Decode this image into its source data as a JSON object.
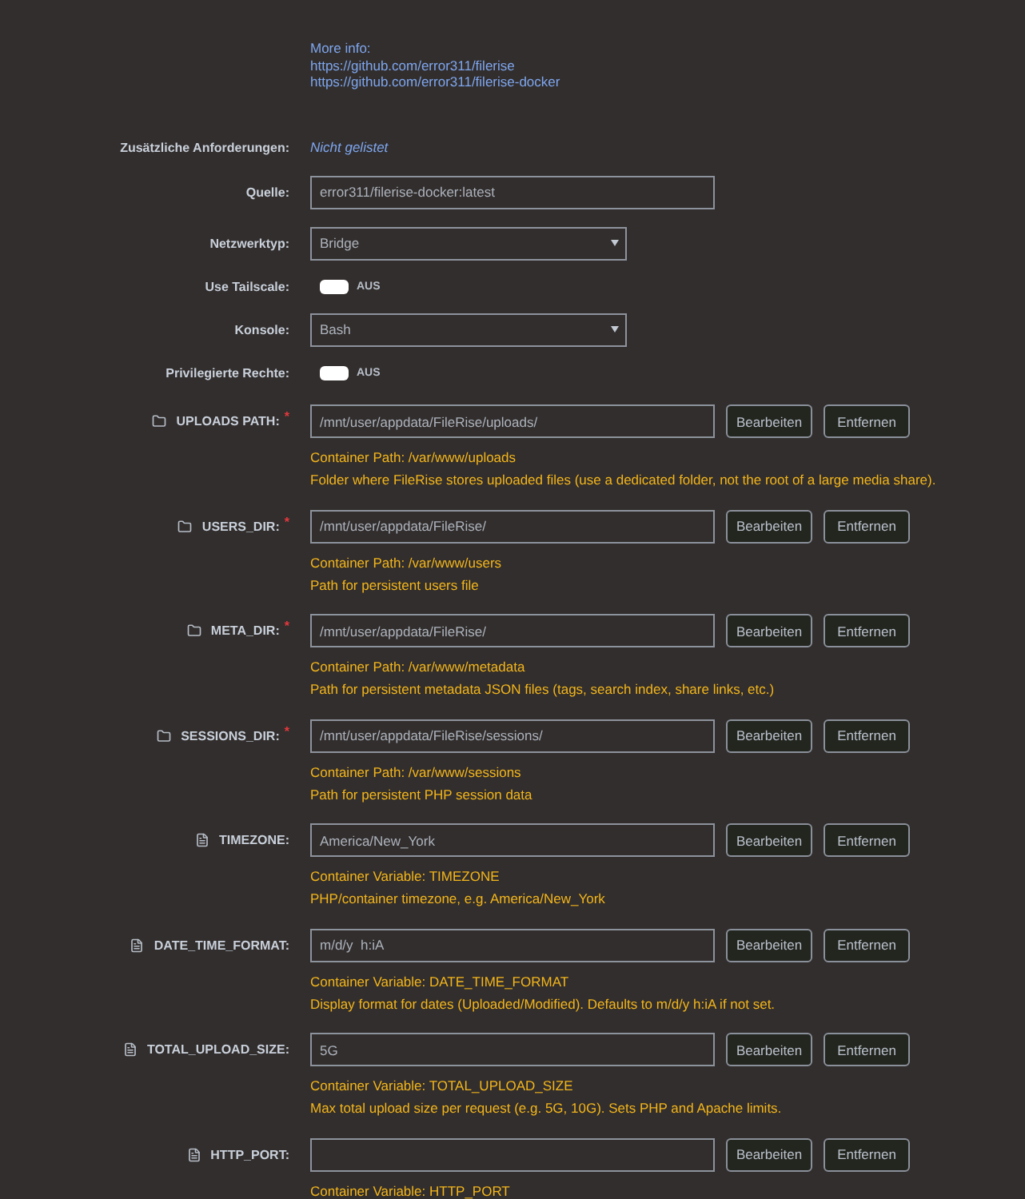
{
  "more_info": {
    "label": "More info:",
    "links": [
      "https://github.com/error311/filerise",
      "https://github.com/error311/filerise-docker"
    ]
  },
  "settings": [
    {
      "kind": "text",
      "label": "Zusätzliche Anforderungen:",
      "value": "Nicht gelistet"
    },
    {
      "kind": "input",
      "label": "Quelle:",
      "value": "error311/filerise-docker:latest"
    },
    {
      "kind": "select",
      "label": "Netzwerktyp:",
      "value": "Bridge"
    },
    {
      "kind": "toggle",
      "label": "Use Tailscale:",
      "on": false,
      "state_label": "AUS"
    },
    {
      "kind": "select",
      "label": "Konsole:",
      "value": "Bash"
    },
    {
      "kind": "toggle",
      "label": "Privilegierte Rechte:",
      "on": false,
      "state_label": "AUS"
    }
  ],
  "mappings": [
    {
      "kind": "path",
      "label": "UPLOADS PATH:",
      "required_mark": "*",
      "value": "/mnt/user/appdata/FileRise/uploads/",
      "buttons": [
        "Bearbeiten",
        "Entfernen"
      ],
      "info": "Container Path: /var/www/uploads",
      "description": "Folder where FileRise stores uploaded files (use a dedicated folder, not the root of a large media share)."
    },
    {
      "kind": "path",
      "label": "USERS_DIR:",
      "required_mark": "*",
      "value": "/mnt/user/appdata/FileRise/",
      "buttons": [
        "Bearbeiten",
        "Entfernen"
      ],
      "info": "Container Path: /var/www/users",
      "description": "Path for persistent users file"
    },
    {
      "kind": "path",
      "label": "META_DIR:",
      "required_mark": "*",
      "value": "/mnt/user/appdata/FileRise/",
      "buttons": [
        "Bearbeiten",
        "Entfernen"
      ],
      "info": "Container Path: /var/www/metadata",
      "description": "Path for persistent metadata JSON files (tags, search index, share links, etc.)"
    },
    {
      "kind": "path",
      "label": "SESSIONS_DIR:",
      "required_mark": "*",
      "value": "/mnt/user/appdata/FileRise/sessions/",
      "buttons": [
        "Bearbeiten",
        "Entfernen"
      ],
      "info": "Container Path: /var/www/sessions",
      "description": "Path for persistent PHP session data"
    },
    {
      "kind": "variable",
      "label": "TIMEZONE:",
      "value": "America/New_York",
      "buttons": [
        "Bearbeiten",
        "Entfernen"
      ],
      "info": "Container Variable: TIMEZONE",
      "description": "PHP/container timezone, e.g. America/New_York"
    },
    {
      "kind": "variable",
      "label": "DATE_TIME_FORMAT:",
      "value": "m/d/y  h:iA",
      "buttons": [
        "Bearbeiten",
        "Entfernen"
      ],
      "info": "Container Variable: DATE_TIME_FORMAT",
      "description": "Display format for dates (Uploaded/Modified). Defaults to m/d/y h:iA if not set."
    },
    {
      "kind": "variable",
      "label": "TOTAL_UPLOAD_SIZE:",
      "value": "5G",
      "buttons": [
        "Bearbeiten",
        "Entfernen"
      ],
      "info": "Container Variable: TOTAL_UPLOAD_SIZE",
      "description": "Max total upload size per request (e.g. 5G, 10G). Sets PHP and Apache limits."
    },
    {
      "kind": "variable",
      "label": "HTTP_PORT:",
      "buttons": [
        "Bearbeiten",
        "Entfernen"
      ],
      "info": "Container Variable: HTTP_PORT"
    }
  ]
}
